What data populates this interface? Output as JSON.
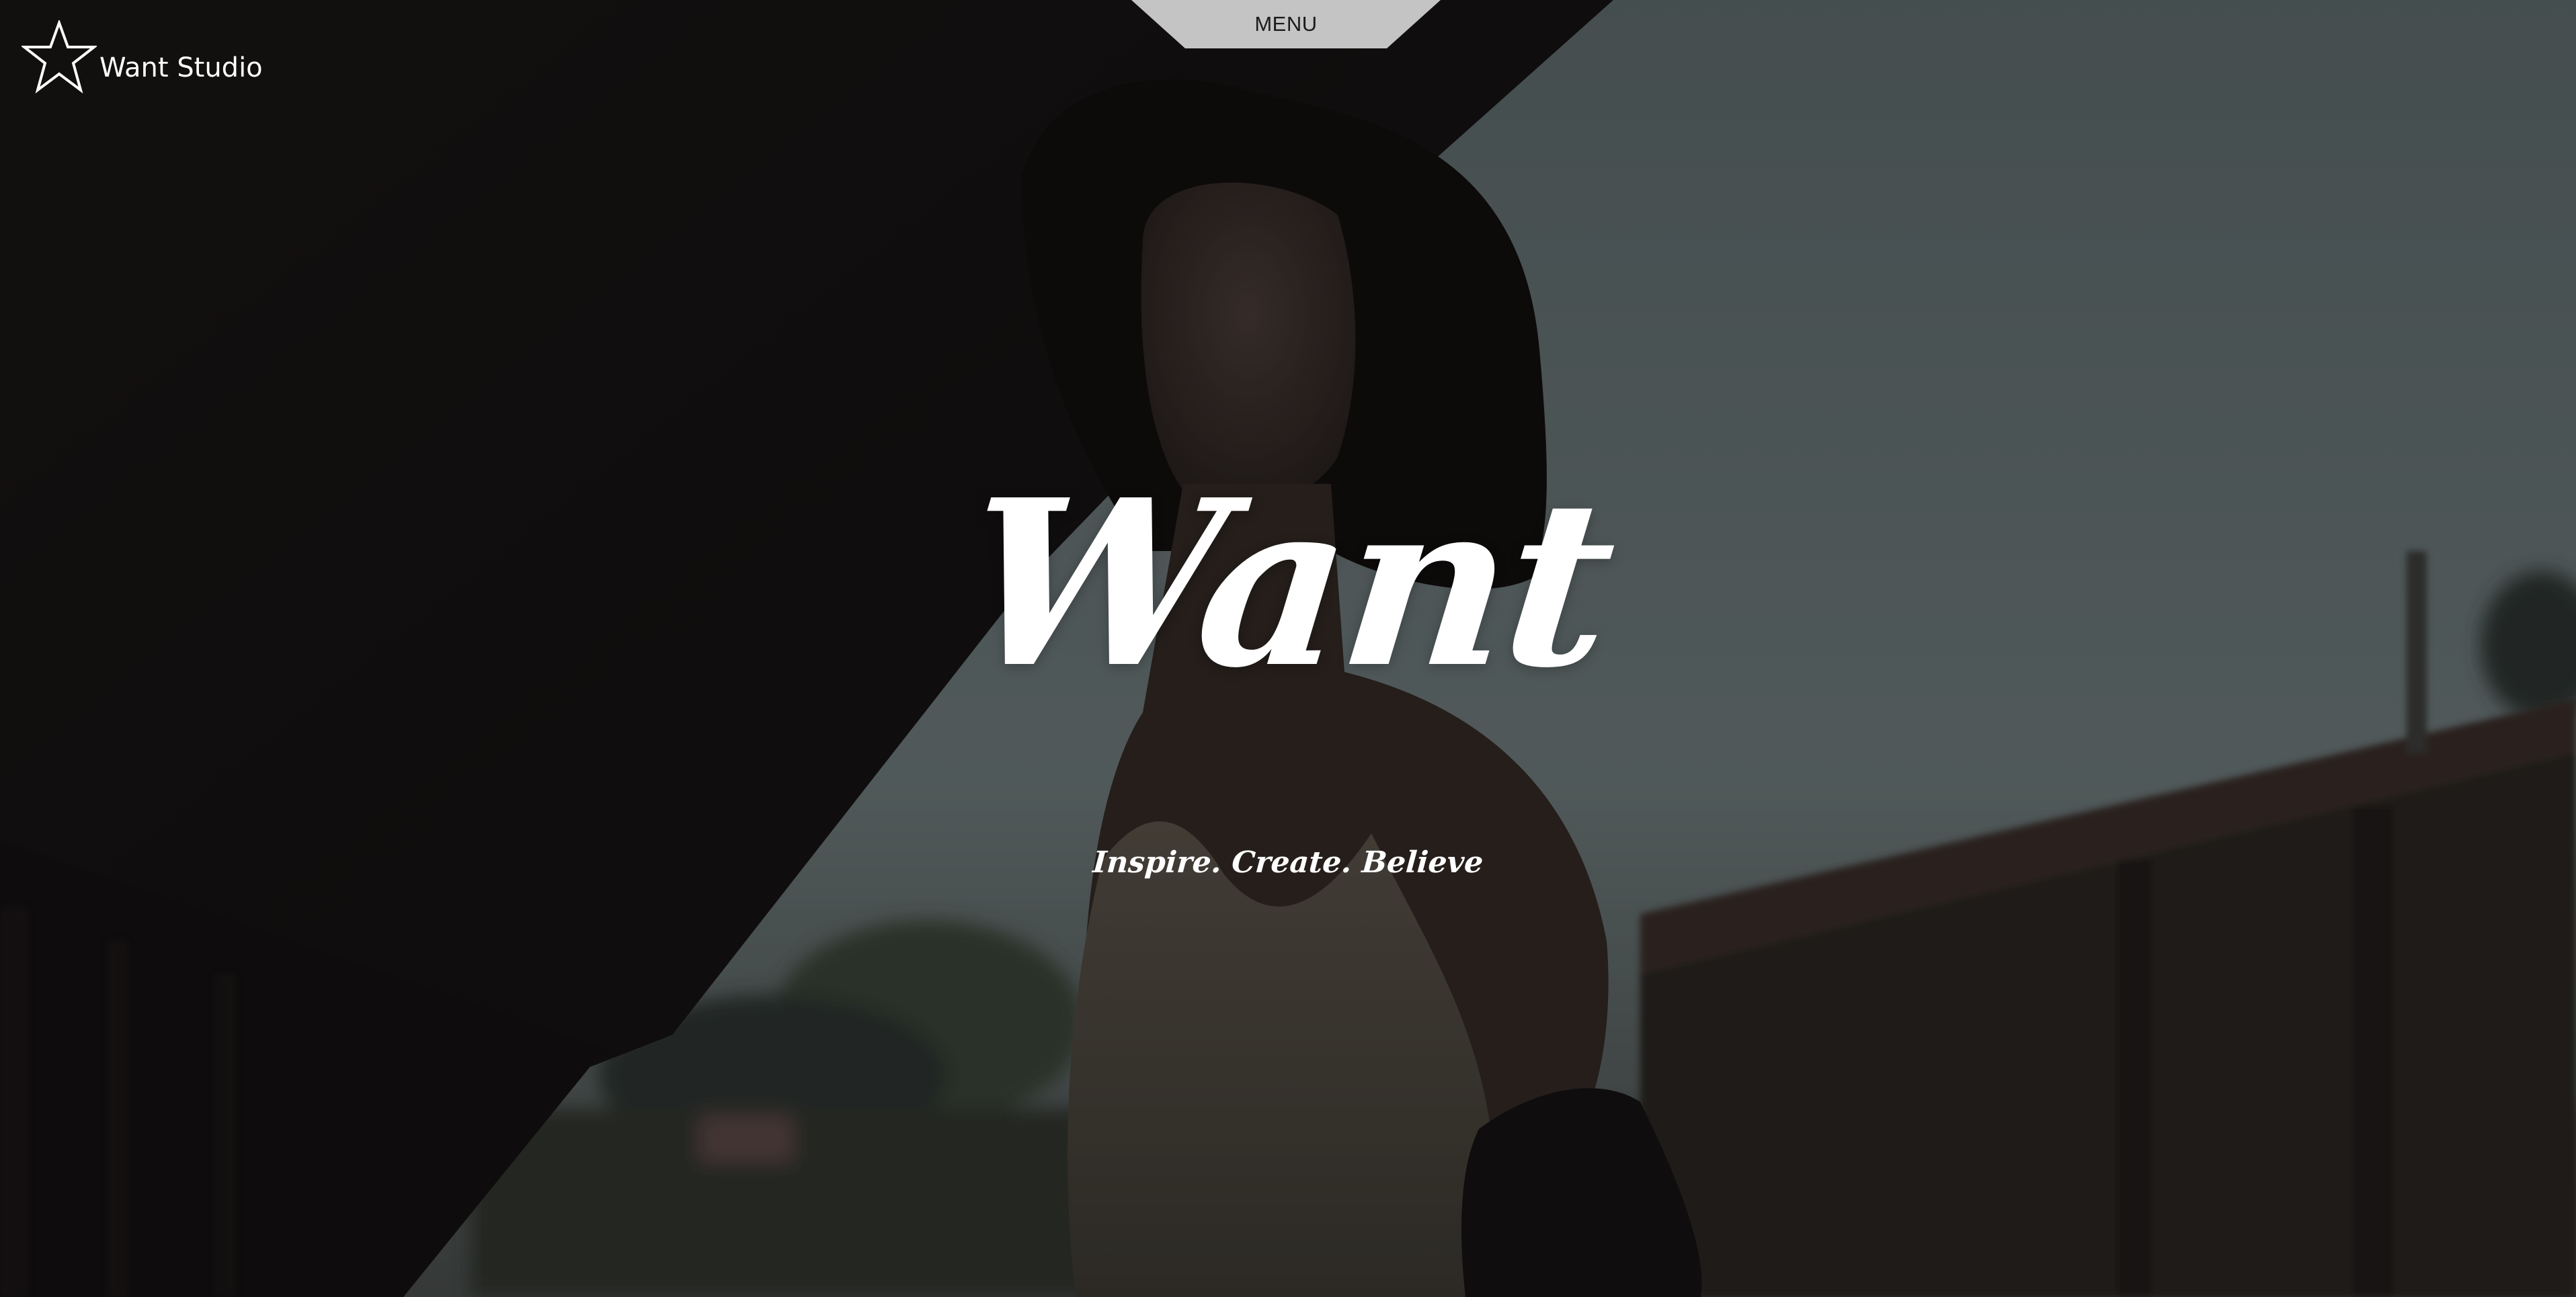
{
  "brand": {
    "name": "Want Studio",
    "logo_icon": "star-outline-icon"
  },
  "nav": {
    "menu_label": "MENU"
  },
  "hero": {
    "headline": "Want",
    "tagline": "Inspire. Create. Believe"
  },
  "colors": {
    "menu_tab_bg": "#c4c4c4",
    "text": "#ffffff",
    "sky": "#6b7778",
    "dark": "#161314"
  }
}
